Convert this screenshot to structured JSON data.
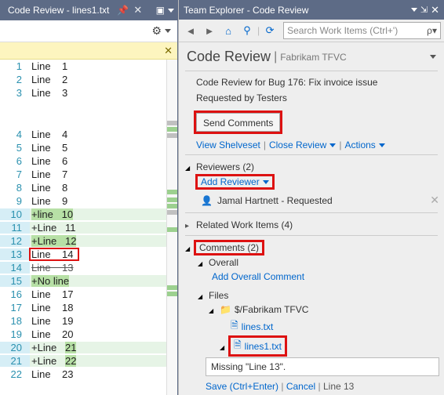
{
  "left": {
    "tab_title": "Code Review - lines1.txt",
    "lines": [
      {
        "num": 1,
        "text": "Line    1"
      },
      {
        "num": 2,
        "text": "Line    2"
      },
      {
        "num": 3,
        "text": "Line    3"
      },
      {
        "gap": true
      },
      {
        "num": 4,
        "text": "Line    4"
      },
      {
        "num": 5,
        "text": "Line    5"
      },
      {
        "num": 6,
        "text": "Line    6"
      },
      {
        "num": 7,
        "text": "Line    7"
      },
      {
        "num": 8,
        "text": "Line    8"
      },
      {
        "num": 9,
        "text": "Line    9"
      },
      {
        "num": 10,
        "text": "+line   10",
        "added": true,
        "hl": true
      },
      {
        "num": 11,
        "text": "+Line   11",
        "added": true
      },
      {
        "num": 12,
        "text": "+Line   12",
        "added": true,
        "hl": true
      },
      {
        "num": 13,
        "text": "Line    14",
        "boxed": true,
        "gutter_removed": true
      },
      {
        "num": 14,
        "text": "Line    13",
        "removed": true
      },
      {
        "num": 15,
        "text": "+No line",
        "added": true,
        "hl": true
      },
      {
        "num": 16,
        "text": "Line    17"
      },
      {
        "num": 17,
        "text": "Line    18"
      },
      {
        "num": 18,
        "text": "Line    19"
      },
      {
        "num": 19,
        "text": "Line    20"
      },
      {
        "num": 20,
        "text": "+Line   21",
        "added": true,
        "hl_num": "21"
      },
      {
        "num": 21,
        "text": "+Line   22",
        "added": true,
        "hl_num": "22"
      },
      {
        "num": 22,
        "text": "Line    23"
      }
    ]
  },
  "right": {
    "title": "Team Explorer - Code Review",
    "search_placeholder": "Search Work Items (Ctrl+')",
    "header_main": "Code Review",
    "header_sub": "Fabrikam TFVC",
    "summary_title": "Code Review for Bug 176: Fix invoice issue",
    "requested_by": "Requested by Testers",
    "send_comments": "Send Comments",
    "view_shelveset": "View Shelveset",
    "close_review": "Close Review",
    "actions": "Actions",
    "reviewers_label": "Reviewers (2)",
    "add_reviewer": "Add Reviewer",
    "reviewer_name": "Jamal Hartnett - Requested",
    "related_items": "Related Work Items (4)",
    "comments_label": "Comments (2)",
    "overall_label": "Overall",
    "add_overall": "Add Overall Comment",
    "files_label": "Files",
    "folder_path": "$/Fabrikam TFVC",
    "file1": "lines.txt",
    "file2": "lines1.txt",
    "comment_text": "Missing \"Line 13\".",
    "save_label": "Save (Ctrl+Enter)",
    "cancel_label": "Cancel",
    "comment_context": "Line 13"
  }
}
